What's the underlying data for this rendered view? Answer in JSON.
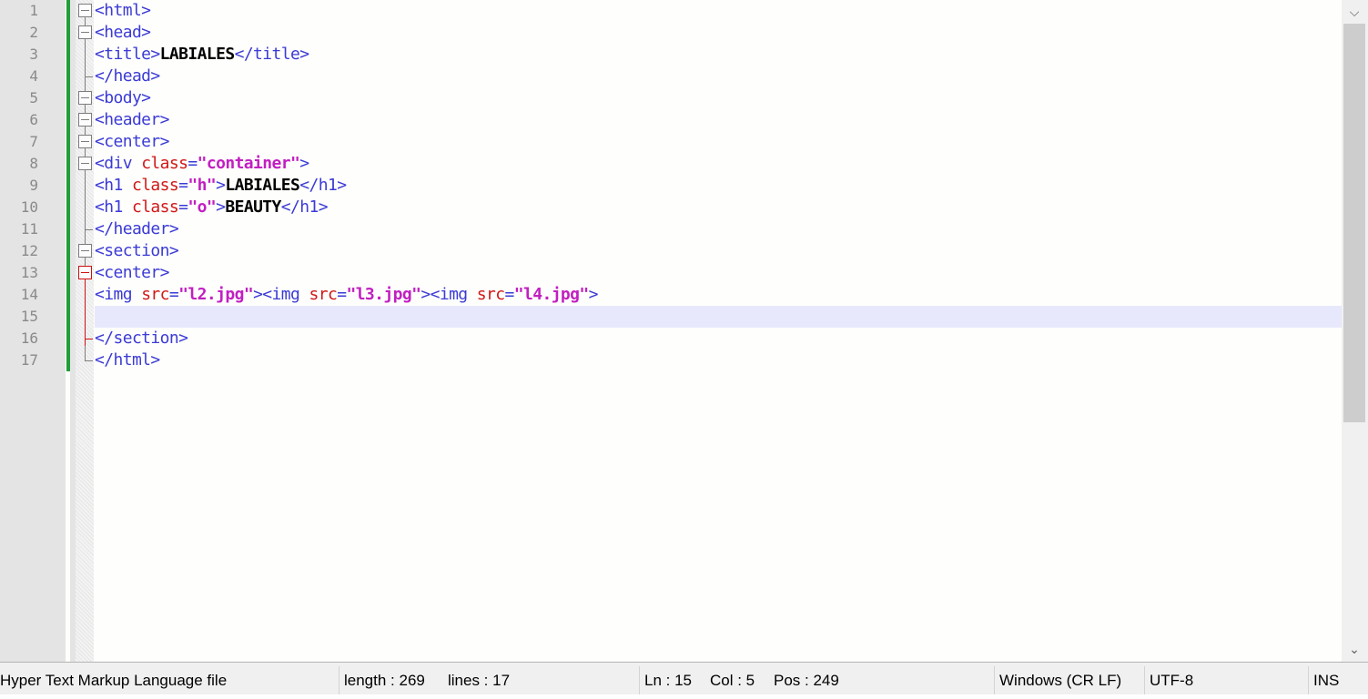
{
  "editor": {
    "line_numbers": [
      "1",
      "2",
      "3",
      "4",
      "5",
      "6",
      "7",
      "8",
      "9",
      "10",
      "11",
      "12",
      "13",
      "14",
      "15",
      "16",
      "17"
    ],
    "lines": [
      [
        {
          "t": "tag",
          "v": "<html>"
        }
      ],
      [
        {
          "t": "tag",
          "v": "<head>"
        }
      ],
      [
        {
          "t": "tag",
          "v": "<title>"
        },
        {
          "t": "txt",
          "v": "LABIALES"
        },
        {
          "t": "tag",
          "v": "</title>"
        }
      ],
      [
        {
          "t": "tag",
          "v": "</head>"
        }
      ],
      [
        {
          "t": "tag",
          "v": "<body>"
        }
      ],
      [
        {
          "t": "tag",
          "v": "<header>"
        }
      ],
      [
        {
          "t": "tag",
          "v": "<center>"
        }
      ],
      [
        {
          "t": "tag",
          "v": "<div "
        },
        {
          "t": "attr",
          "v": "class"
        },
        {
          "t": "tag",
          "v": "="
        },
        {
          "t": "val",
          "v": "\"container\""
        },
        {
          "t": "tag",
          "v": ">"
        }
      ],
      [
        {
          "t": "tag",
          "v": "<h1 "
        },
        {
          "t": "attr",
          "v": "class"
        },
        {
          "t": "tag",
          "v": "="
        },
        {
          "t": "val",
          "v": "\"h\""
        },
        {
          "t": "tag",
          "v": ">"
        },
        {
          "t": "txt",
          "v": "LABIALES"
        },
        {
          "t": "tag",
          "v": "</h1>"
        }
      ],
      [
        {
          "t": "tag",
          "v": "<h1 "
        },
        {
          "t": "attr",
          "v": "class"
        },
        {
          "t": "tag",
          "v": "="
        },
        {
          "t": "val",
          "v": "\"o\""
        },
        {
          "t": "tag",
          "v": ">"
        },
        {
          "t": "txt",
          "v": "BEAUTY"
        },
        {
          "t": "tag",
          "v": "</h1>"
        }
      ],
      [
        {
          "t": "tag",
          "v": "</header>"
        }
      ],
      [
        {
          "t": "tag",
          "v": "<section>"
        }
      ],
      [
        {
          "t": "tag",
          "v": "<center>"
        }
      ],
      [
        {
          "t": "tag",
          "v": "<img "
        },
        {
          "t": "attr",
          "v": "src"
        },
        {
          "t": "tag",
          "v": "="
        },
        {
          "t": "val",
          "v": "\"l2.jpg\""
        },
        {
          "t": "tag",
          "v": "><img "
        },
        {
          "t": "attr",
          "v": "src"
        },
        {
          "t": "tag",
          "v": "="
        },
        {
          "t": "val",
          "v": "\"l3.jpg\""
        },
        {
          "t": "tag",
          "v": "><img "
        },
        {
          "t": "attr",
          "v": "src"
        },
        {
          "t": "tag",
          "v": "="
        },
        {
          "t": "val",
          "v": "\"l4.jpg\""
        },
        {
          "t": "tag",
          "v": ">"
        }
      ],
      [],
      [
        {
          "t": "tag",
          "v": "</section>"
        }
      ],
      [
        {
          "t": "tag",
          "v": "</html>"
        }
      ]
    ]
  },
  "statusbar": {
    "file_type": "Hyper Text Markup Language file",
    "length": "length : 269",
    "lines": "lines : 17",
    "ln": "Ln : 15",
    "col": "Col : 5",
    "pos": "Pos : 249",
    "eol": "Windows (CR LF)",
    "encoding": "UTF-8",
    "mode": "INS"
  },
  "scrollbar": {
    "up_icon": "chevron-up-icon",
    "down_icon": "chevron-down-icon"
  }
}
